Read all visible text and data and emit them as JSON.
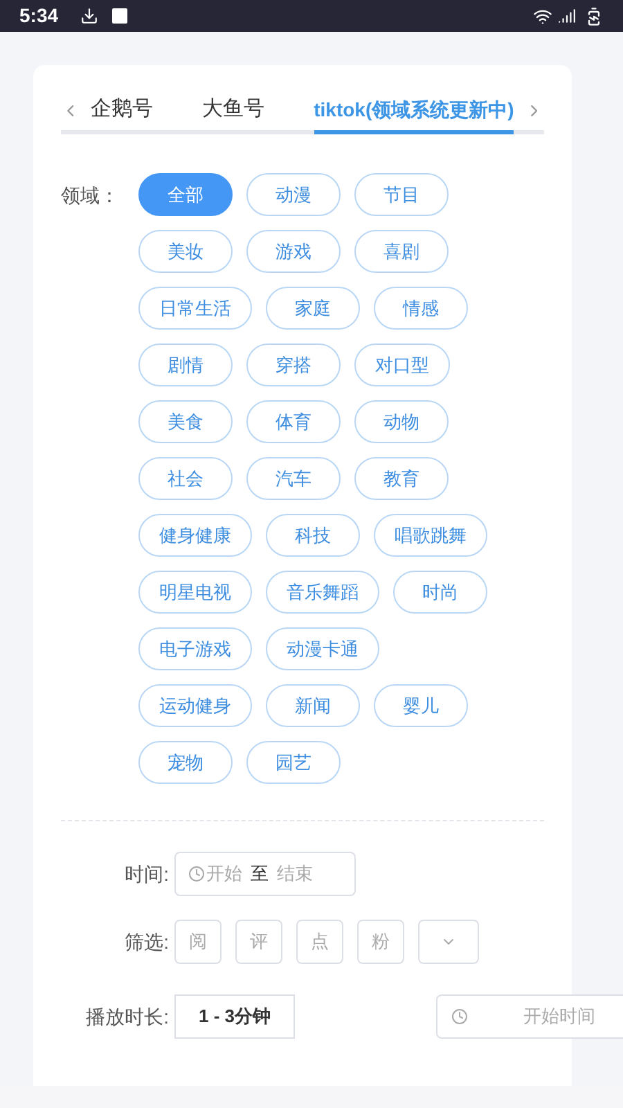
{
  "status_bar": {
    "time": "5:34"
  },
  "tabs": [
    {
      "label": "企鹅号",
      "selected": false
    },
    {
      "label": "大鱼号",
      "selected": false
    },
    {
      "label": "tiktok(领域系统更新中)",
      "selected": true
    }
  ],
  "domain": {
    "label": "领域：",
    "rows": [
      [
        {
          "label": "全部",
          "selected": true
        },
        {
          "label": "动漫",
          "selected": false
        },
        {
          "label": "节目",
          "selected": false
        }
      ],
      [
        {
          "label": "美妆",
          "selected": false
        },
        {
          "label": "游戏",
          "selected": false
        },
        {
          "label": "喜剧",
          "selected": false
        }
      ],
      [
        {
          "label": "日常生活",
          "selected": false
        },
        {
          "label": "家庭",
          "selected": false
        },
        {
          "label": "情感",
          "selected": false
        }
      ],
      [
        {
          "label": "剧情",
          "selected": false
        },
        {
          "label": "穿搭",
          "selected": false
        },
        {
          "label": "对口型",
          "selected": false
        }
      ],
      [
        {
          "label": "美食",
          "selected": false
        },
        {
          "label": "体育",
          "selected": false
        },
        {
          "label": "动物",
          "selected": false
        }
      ],
      [
        {
          "label": "社会",
          "selected": false
        },
        {
          "label": "汽车",
          "selected": false
        },
        {
          "label": "教育",
          "selected": false
        }
      ],
      [
        {
          "label": "健身健康",
          "selected": false
        },
        {
          "label": "科技",
          "selected": false
        },
        {
          "label": "唱歌跳舞",
          "selected": false
        }
      ],
      [
        {
          "label": "明星电视",
          "selected": false
        },
        {
          "label": "音乐舞蹈",
          "selected": false
        },
        {
          "label": "时尚",
          "selected": false
        }
      ],
      [
        {
          "label": "电子游戏",
          "selected": false
        },
        {
          "label": "动漫卡通",
          "selected": false
        }
      ],
      [
        {
          "label": "运动健身",
          "selected": false
        },
        {
          "label": "新闻",
          "selected": false
        },
        {
          "label": "婴儿",
          "selected": false
        }
      ],
      [
        {
          "label": "宠物",
          "selected": false
        },
        {
          "label": "园艺",
          "selected": false
        }
      ]
    ]
  },
  "time": {
    "label": "时间:",
    "start_placeholder": "开始",
    "separator": "至",
    "end_placeholder": "结束"
  },
  "filter": {
    "label": "筛选:",
    "options": [
      "阅",
      "评",
      "点",
      "粉"
    ]
  },
  "duration": {
    "label": "播放时长:",
    "value": "1 - 3分钟",
    "start_time_placeholder": "开始时间"
  }
}
